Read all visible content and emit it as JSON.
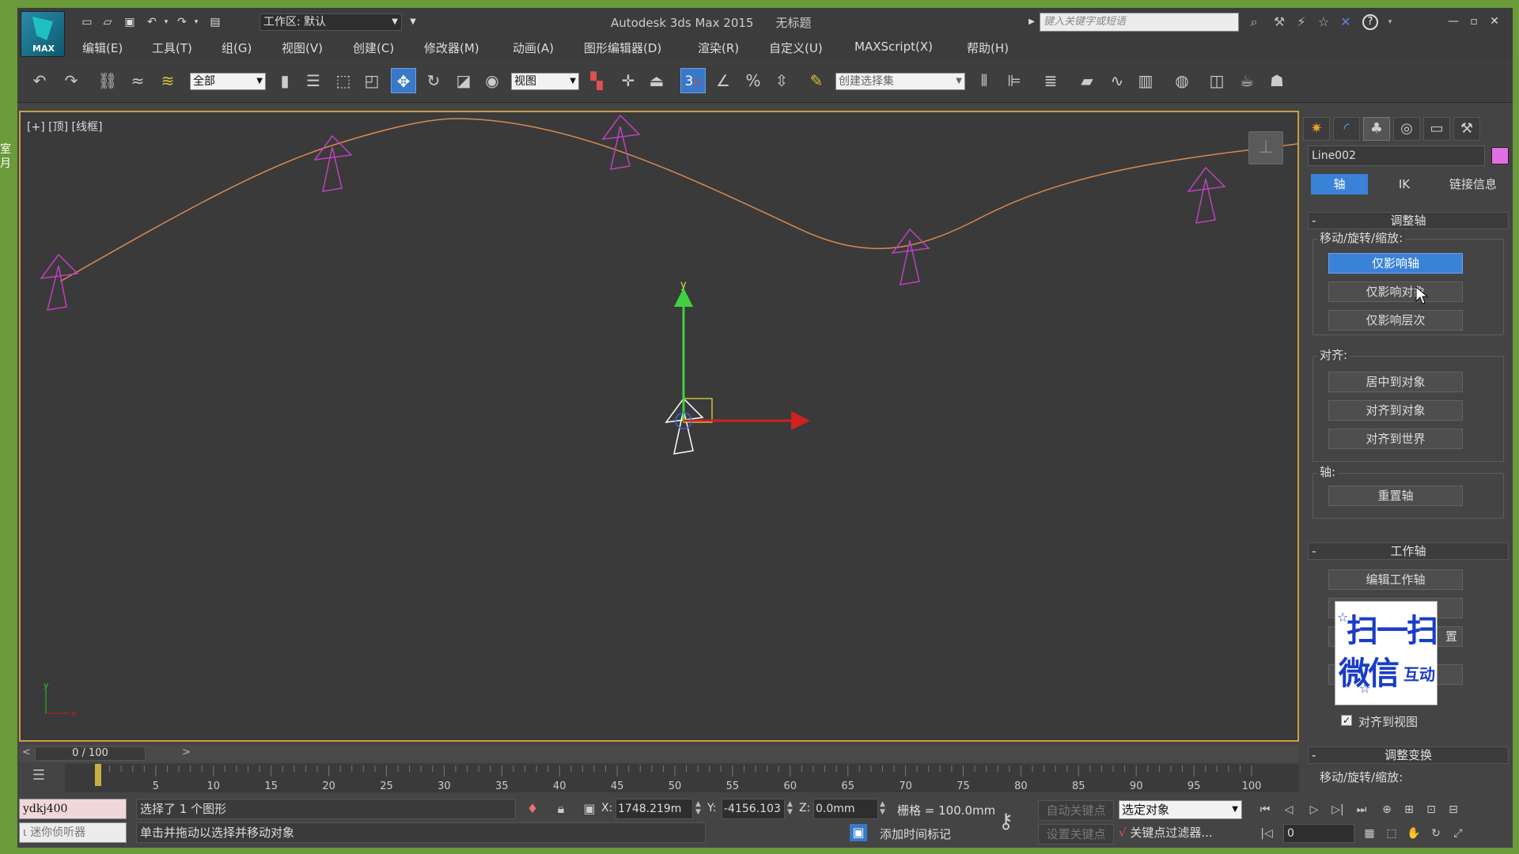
{
  "app": {
    "title": "Autodesk 3ds Max  2015",
    "doc_title": "无标题",
    "logo_text": "MAX",
    "workspace_label": "工作区: 默认",
    "search_placeholder": "键入关键字或短语",
    "side_text": "室\n月"
  },
  "menu": {
    "items": [
      "编辑(E)",
      "工具(T)",
      "组(G)",
      "视图(V)",
      "创建(C)",
      "修改器(M)",
      "动画(A)",
      "图形编辑器(D)",
      "渲染(R)",
      "自定义(U)",
      "MAXScript(X)",
      "帮助(H)"
    ]
  },
  "toolbar": {
    "filter_value": "全部",
    "ref_coord_value": "视图",
    "snap_value": "3",
    "selection_set_value": "创建选择集"
  },
  "viewport": {
    "label": "[+] [顶] [线框]",
    "spline_color": "#d88a50",
    "object_color": "#c040c0",
    "axis_x_label": "x",
    "axis_y_label": "y"
  },
  "command_panel": {
    "object_name": "Line002",
    "object_color": "#e070e0",
    "tabs": {
      "pivot": "轴",
      "ik": "IK",
      "link_info": "链接信息"
    },
    "adjust_pivot": {
      "title": "调整轴",
      "move_rotate_scale_label": "移动/旋转/缩放:",
      "affect_pivot_only": "仅影响轴",
      "affect_object_only": "仅影响对象",
      "affect_hierarchy_only": "仅影响层次",
      "alignment_label": "对齐:",
      "center_to_object": "居中到对象",
      "align_to_object": "对齐到对象",
      "align_to_world": "对齐到世界",
      "pivot_label": "轴:",
      "reset_pivot": "重置轴"
    },
    "working_pivot": {
      "title": "工作轴",
      "edit_working_pivot": "编辑工作轴",
      "partial_button": "置",
      "align_to_view": "对齐到视图",
      "align_to_view_checked": true
    },
    "adjust_transform": {
      "title": "调整变换",
      "move_rotate_scale_label": "移动/旋转/缩放:"
    },
    "qr_overlay": {
      "line1": "扫一扫",
      "line2": "微信",
      "line3": "互动"
    }
  },
  "timeline": {
    "frame_display": "0 / 100",
    "ticks": [
      5,
      10,
      15,
      20,
      25,
      30,
      35,
      40,
      45,
      50,
      55,
      60,
      65,
      70,
      75,
      80,
      85,
      90,
      95,
      100
    ]
  },
  "status": {
    "user": "ydkj400",
    "listener": "迷你侦听器",
    "selection": "选择了 1 个图形",
    "prompt": "单击并拖动以选择并移动对象",
    "x_label": "X:",
    "x_value": "1748.219m",
    "y_label": "Y:",
    "y_value": "-4156.103",
    "z_label": "Z:",
    "z_value": "0.0mm",
    "grid": "栅格 = 100.0mm",
    "add_time_tag": "添加时间标记",
    "auto_key": "自动关键点",
    "set_key": "设置关键点",
    "key_mode_value": "选定对象",
    "key_filters": "关键点过滤器...",
    "current_frame": "0"
  }
}
